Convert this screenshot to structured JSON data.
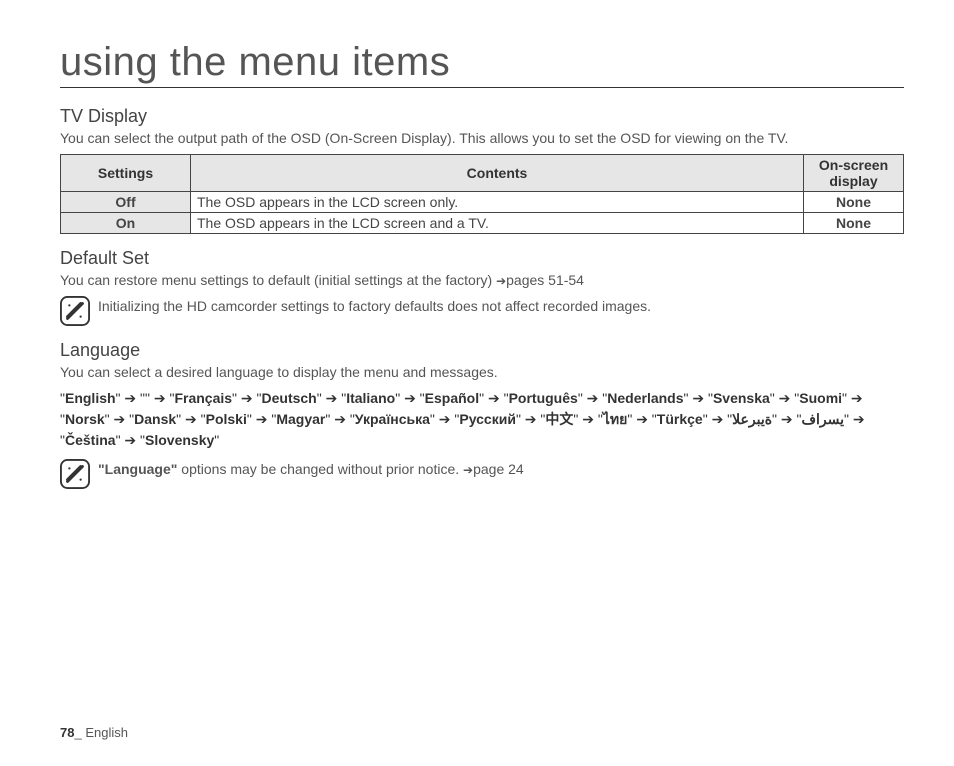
{
  "title": "using the menu items",
  "tv_display": {
    "heading": "TV Display",
    "desc": "You can select the output path of the OSD (On-Screen Display). This allows you to set the OSD for viewing on the TV.",
    "headers": {
      "c1": "Settings",
      "c2": "Contents",
      "c3": "On-screen display"
    },
    "rows": [
      {
        "setting": "Off",
        "contents": "The OSD appears in the LCD screen only.",
        "osd": "None"
      },
      {
        "setting": "On",
        "contents": "The OSD appears in the LCD screen and a TV.",
        "osd": "None"
      }
    ]
  },
  "default_set": {
    "heading": "Default Set",
    "desc_prefix": "You can restore menu settings to default (initial settings at the factory) ",
    "desc_ref": "pages 51-54",
    "note": "Initializing the HD camcorder settings to factory defaults does not affect recorded images."
  },
  "language": {
    "heading": "Language",
    "desc": "You can select a desired language to display the menu and messages.",
    "list": [
      "English",
      "",
      "Français",
      "Deutsch",
      "Italiano",
      "Español",
      "Português",
      "Nederlands",
      "Svenska",
      "Suomi",
      "Norsk",
      "Dansk",
      "Polski",
      "Magyar",
      "Українська",
      "Русский",
      "中文",
      "ไทย",
      "Türkçe",
      "یسراف",
      "ةيبرعلا",
      "Čeština",
      "Slovensky"
    ],
    "note_bold": "\"Language\"",
    "note_rest": " options may be changed without prior notice. ",
    "note_ref": "page 24"
  },
  "footer": {
    "page": "78",
    "sep": "_ ",
    "lang": "English"
  }
}
